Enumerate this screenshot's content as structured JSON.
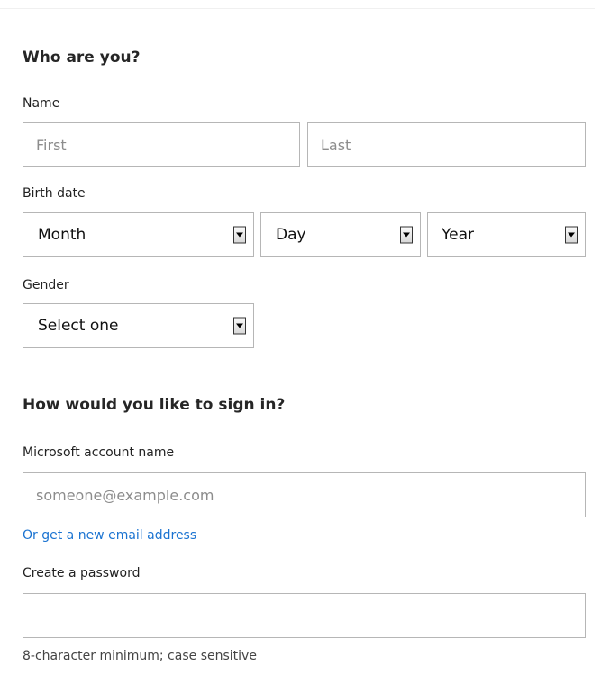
{
  "who_section": {
    "heading": "Who are you?",
    "name_label": "Name",
    "first_placeholder": "First",
    "last_placeholder": "Last",
    "birth_label": "Birth date",
    "month_value": "Month",
    "day_value": "Day",
    "year_value": "Year",
    "gender_label": "Gender",
    "gender_value": "Select one"
  },
  "signin_section": {
    "heading": "How would you like to sign in?",
    "account_label": "Microsoft account name",
    "account_placeholder": "someone@example.com",
    "new_email_link": "Or get a new email address",
    "password_label": "Create a password",
    "password_value": "",
    "password_hint": "8-character minimum; case sensitive"
  },
  "colors": {
    "link": "#1a73d1",
    "border": "#b6b6b6",
    "placeholder": "#8c8c8c"
  },
  "icons": {
    "dropdown": "chevron-down-icon"
  }
}
